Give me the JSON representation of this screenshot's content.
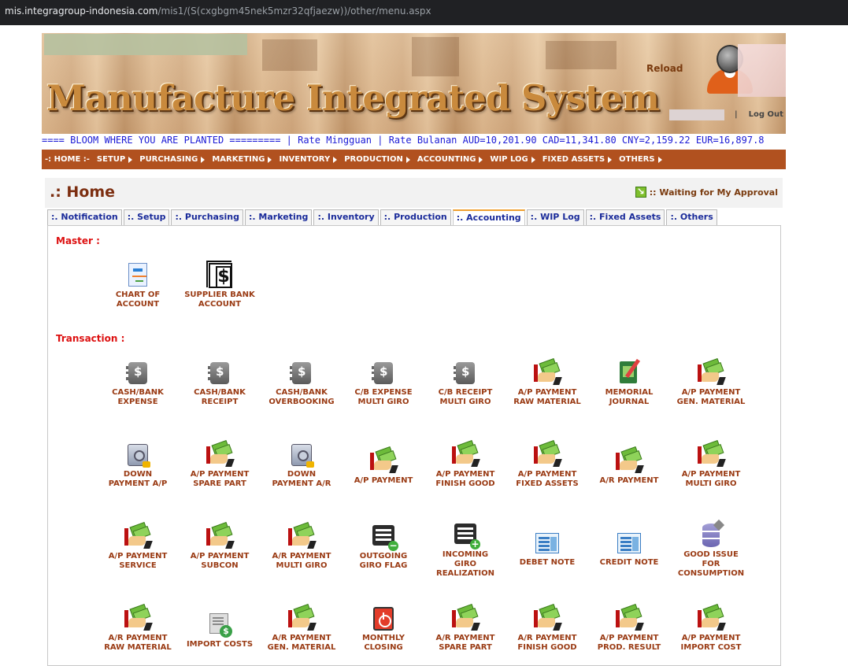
{
  "browser": {
    "url_host": "mis.integragroup-indonesia.com",
    "url_path": "/mis1/(S(cxgbgm45nek5mzr32qfjaezw))/other/menu.aspx"
  },
  "banner": {
    "title": "Manufacture Integrated System",
    "reload_label": "Reload",
    "logout_sep": "|",
    "logout_label": "Log Out"
  },
  "marquee": {
    "motto": "==== BLOOM WHERE YOU ARE PLANTED ========= | Rate Mingguan | Rate Bulanan AUD=10,201.90 CAD=11,341.80 CNY=2,159.22 EUR=16,897.8"
  },
  "mainnav": {
    "items": [
      {
        "label": "-: HOME :-",
        "arrow": false
      },
      {
        "label": "SETUP",
        "arrow": true
      },
      {
        "label": "PURCHASING",
        "arrow": true
      },
      {
        "label": "MARKETING",
        "arrow": true
      },
      {
        "label": "INVENTORY",
        "arrow": true
      },
      {
        "label": "PRODUCTION",
        "arrow": true
      },
      {
        "label": "ACCOUNTING",
        "arrow": true
      },
      {
        "label": "WIP LOG",
        "arrow": true
      },
      {
        "label": "FIXED ASSETS",
        "arrow": true
      },
      {
        "label": "OTHERS",
        "arrow": true
      }
    ]
  },
  "home": {
    "title": ".: Home",
    "waiting_label": ":: Waiting for My Approval"
  },
  "tabs": {
    "items": [
      {
        "label": ":. Notification"
      },
      {
        "label": ":. Setup"
      },
      {
        "label": ":. Purchasing"
      },
      {
        "label": ":. Marketing"
      },
      {
        "label": ":. Inventory"
      },
      {
        "label": ":. Production"
      },
      {
        "label": ":. Accounting",
        "active": true
      },
      {
        "label": ":. WIP Log"
      },
      {
        "label": ":. Fixed Assets"
      },
      {
        "label": ":. Others"
      }
    ]
  },
  "master": {
    "label": "Master :",
    "apps": [
      {
        "icon": "chart-of-account-icon",
        "line1": "CHART OF",
        "line2": "ACCOUNT"
      },
      {
        "icon": "supplier-bank-icon",
        "line1": "SUPPLIER BANK",
        "line2": "ACCOUNT"
      }
    ]
  },
  "transaction": {
    "label": "Transaction :",
    "rows": [
      [
        {
          "icon": "cashbook-icon",
          "line1": "CASH/BANK",
          "line2": "EXPENSE"
        },
        {
          "icon": "cashbook-icon",
          "line1": "CASH/BANK",
          "line2": "RECEIPT"
        },
        {
          "icon": "cashbook-icon",
          "line1": "CASH/BANK",
          "line2": "OVERBOOKING"
        },
        {
          "icon": "cashbook-icon",
          "line1": "C/B EXPENSE",
          "line2": "MULTI GIRO"
        },
        {
          "icon": "cashbook-icon",
          "line1": "C/B RECEIPT",
          "line2": "MULTI GIRO"
        },
        {
          "icon": "payment-hand-icon",
          "line1": "A/P PAYMENT",
          "line2": "RAW MATERIAL"
        },
        {
          "icon": "journal-icon",
          "line1": "MEMORIAL",
          "line2": "JOURNAL"
        },
        {
          "icon": "payment-hand-icon",
          "line1": "A/P PAYMENT",
          "line2": "GEN. MATERIAL"
        }
      ],
      [
        {
          "icon": "safe-icon",
          "line1": "DOWN",
          "line2": "PAYMENT A/P"
        },
        {
          "icon": "payment-hand-icon",
          "line1": "A/P PAYMENT",
          "line2": "SPARE PART"
        },
        {
          "icon": "safe-icon",
          "line1": "DOWN",
          "line2": "PAYMENT A/R"
        },
        {
          "icon": "payment-hand-icon",
          "line1": "A/P PAYMENT",
          "line2": ""
        },
        {
          "icon": "payment-hand-icon",
          "line1": "A/P PAYMENT",
          "line2": "FINISH GOOD"
        },
        {
          "icon": "payment-hand-icon",
          "line1": "A/P PAYMENT",
          "line2": "FIXED ASSETS"
        },
        {
          "icon": "payment-hand-icon",
          "line1": "A/R PAYMENT",
          "line2": ""
        },
        {
          "icon": "payment-hand-icon",
          "line1": "A/P PAYMENT",
          "line2": "MULTI GIRO"
        }
      ],
      [
        {
          "icon": "payment-hand-icon",
          "line1": "A/P PAYMENT",
          "line2": "SERVICE"
        },
        {
          "icon": "payment-hand-icon",
          "line1": "A/P PAYMENT",
          "line2": "SUBCON"
        },
        {
          "icon": "payment-hand-icon",
          "line1": "A/R PAYMENT",
          "line2": "MULTI GIRO"
        },
        {
          "icon": "outgoing-giro-icon",
          "line1": "OUTGOING",
          "line2": "GIRO FLAG"
        },
        {
          "icon": "incoming-giro-icon",
          "line1": "INCOMING",
          "line2": "GIRO",
          "line3": "REALIZATION"
        },
        {
          "icon": "debet-note-icon",
          "line1": "DEBET NOTE",
          "line2": ""
        },
        {
          "icon": "credit-note-icon",
          "line1": "CREDIT NOTE",
          "line2": ""
        },
        {
          "icon": "database-icon",
          "line1": "GOOD ISSUE",
          "line2": "FOR",
          "line3": "CONSUMPTION"
        }
      ],
      [
        {
          "icon": "payment-hand-icon",
          "line1": "A/R PAYMENT",
          "line2": "RAW MATERIAL"
        },
        {
          "icon": "import-costs-icon",
          "line1": "IMPORT COSTS",
          "line2": ""
        },
        {
          "icon": "payment-hand-icon",
          "line1": "A/R PAYMENT",
          "line2": "GEN. MATERIAL"
        },
        {
          "icon": "monthly-closing-icon",
          "line1": "MONTHLY",
          "line2": "CLOSING"
        },
        {
          "icon": "payment-hand-icon",
          "line1": "A/R PAYMENT",
          "line2": "SPARE PART"
        },
        {
          "icon": "payment-hand-icon",
          "line1": "A/R PAYMENT",
          "line2": "FINISH GOOD"
        },
        {
          "icon": "payment-hand-icon",
          "line1": "A/P PAYMENT",
          "line2": "PROD. RESULT"
        },
        {
          "icon": "payment-hand-icon",
          "line1": "A/P PAYMENT",
          "line2": "IMPORT COST"
        }
      ]
    ]
  },
  "colors": {
    "nav_bg": "#b1511f",
    "section_label": "#dd1111",
    "app_label": "#9a3b14",
    "tab_text": "#1a2b9a",
    "marquee_text": "#1b1bd6"
  }
}
